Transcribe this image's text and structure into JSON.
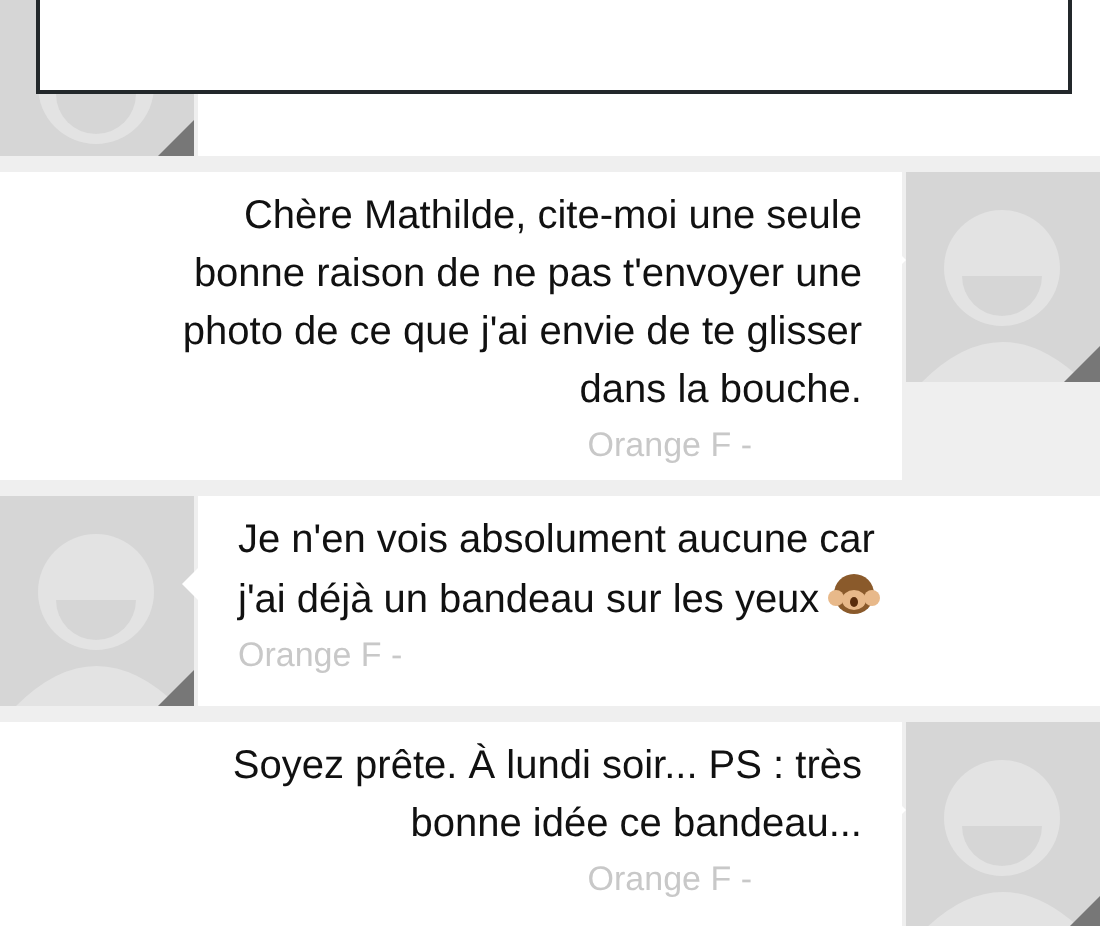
{
  "messages": [
    {
      "kind": "incoming",
      "redacted": true
    },
    {
      "kind": "outgoing",
      "lines": [
        "Chère Mathilde, cite-moi une seule",
        "bonne raison de ne pas t'envoyer une",
        "photo de ce que j'ai envie de te glisser",
        "dans la bouche."
      ],
      "sender": "Orange F -",
      "emoji": false
    },
    {
      "kind": "incoming",
      "lines": [
        "Je n'en vois absolument aucune car",
        "j'ai déjà un bandeau sur les yeux"
      ],
      "sender": "Orange F -",
      "emoji": true
    },
    {
      "kind": "outgoing",
      "lines": [
        "Soyez prête. À lundi soir... PS : très",
        "bonne idée ce bandeau..."
      ],
      "sender": "Orange F -",
      "emoji": false
    }
  ]
}
